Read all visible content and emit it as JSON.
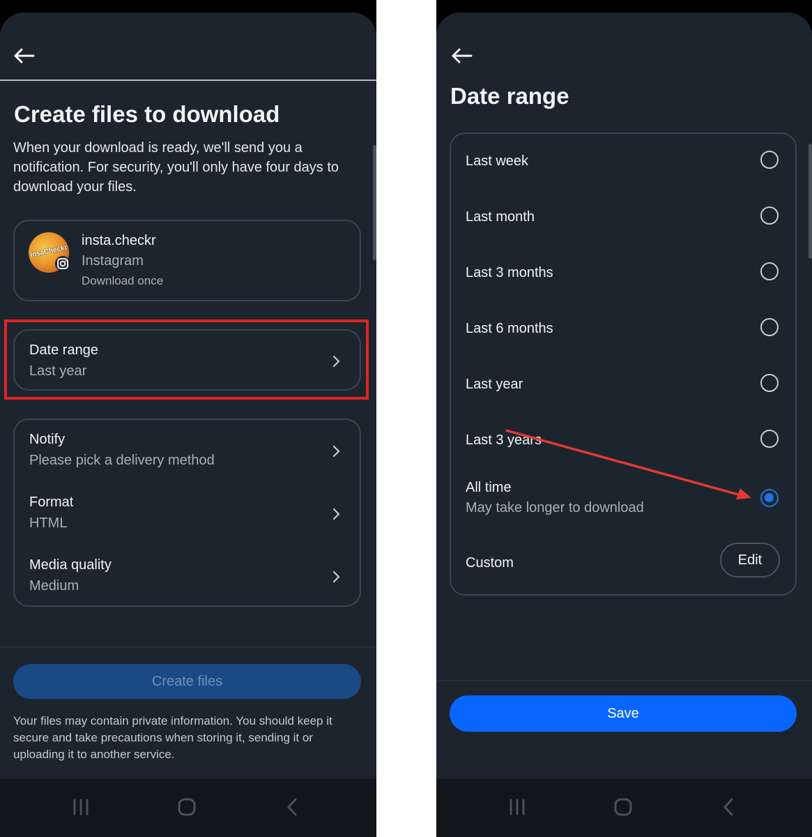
{
  "left": {
    "title": "Create files to download",
    "description": "When your download is ready, we'll send you a notification. For security, you'll only have four days to download your files.",
    "account": {
      "name": "insta.checkr",
      "platform": "Instagram",
      "frequency": "Download once",
      "avatar_text": "InsaCheckr"
    },
    "date_range": {
      "title": "Date range",
      "value": "Last year"
    },
    "settings": [
      {
        "title": "Notify",
        "value": "Please pick a delivery method"
      },
      {
        "title": "Format",
        "value": "HTML"
      },
      {
        "title": "Media quality",
        "value": "Medium"
      }
    ],
    "create_button": "Create files",
    "footnote": "Your files may contain private information. You should keep it secure and take precautions when storing it, sending it or uploading it to another service."
  },
  "right": {
    "title": "Date range",
    "options": [
      {
        "label": "Last week",
        "selected": false
      },
      {
        "label": "Last month",
        "selected": false
      },
      {
        "label": "Last 3 months",
        "selected": false
      },
      {
        "label": "Last 6 months",
        "selected": false
      },
      {
        "label": "Last year",
        "selected": false
      },
      {
        "label": "Last 3 years",
        "selected": false
      },
      {
        "label": "All time",
        "sublabel": "May take longer to download",
        "selected": true
      }
    ],
    "custom": {
      "label": "Custom",
      "button": "Edit"
    },
    "save_button": "Save"
  },
  "colors": {
    "background": "#1c252e",
    "accent": "#1b74e4",
    "highlight_box": "#e02424",
    "arrow": "#e53935"
  }
}
